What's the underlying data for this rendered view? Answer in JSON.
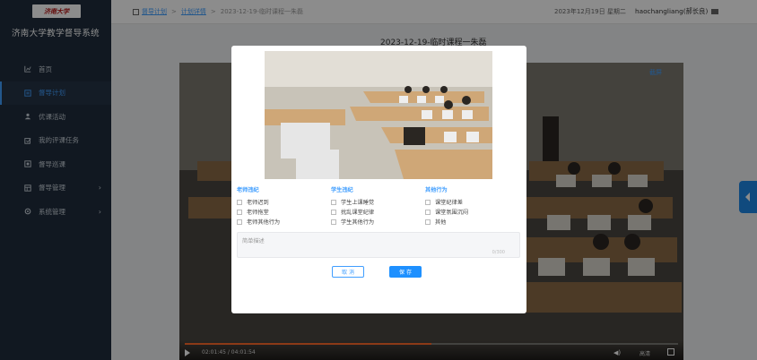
{
  "sidebar": {
    "logo_text": "济南大学",
    "title": "济南大学教学督导系统",
    "items": [
      {
        "label": "首页",
        "icon": "chart-icon"
      },
      {
        "label": "督导计划",
        "icon": "plan-icon",
        "active": true
      },
      {
        "label": "优课活动",
        "icon": "user-icon"
      },
      {
        "label": "我的评课任务",
        "icon": "task-icon"
      },
      {
        "label": "督导巡课",
        "icon": "patrol-icon"
      },
      {
        "label": "督导管理",
        "icon": "manage-icon"
      },
      {
        "label": "系统管理",
        "icon": "settings-icon"
      }
    ],
    "arrow": "›"
  },
  "header": {
    "breadcrumb": [
      "督导计划",
      "计划详情",
      "2023-12-19-临时课程一朱磊"
    ],
    "date": "2023年12月19日 星期二",
    "user": "haochangliang(郝长良)"
  },
  "content": {
    "lesson_title": "2023-12-19-临时课程一朱磊",
    "screenshot_label": "截屏",
    "video": {
      "time": "02:01:45 / 04:01:54",
      "quality": "高清",
      "progress": 0.5
    }
  },
  "modal": {
    "columns": [
      {
        "title": "老师违纪",
        "options": [
          "老师迟到",
          "老师拖堂",
          "老师其他行为"
        ]
      },
      {
        "title": "学生违纪",
        "options": [
          "学生上课睡觉",
          "扰乱课堂纪律",
          "学生其他行为"
        ]
      },
      {
        "title": "其他行为",
        "options": [
          "课堂纪律差",
          "课堂氛围沉闷",
          "其他"
        ]
      }
    ],
    "desc_placeholder": "简单描述",
    "desc_count": "0/300",
    "cancel_label": "取 消",
    "save_label": "保 存"
  },
  "colors": {
    "sidebar_bg": "#1f2d3d",
    "accent": "#409eff",
    "save_button": "#1e90ff"
  }
}
